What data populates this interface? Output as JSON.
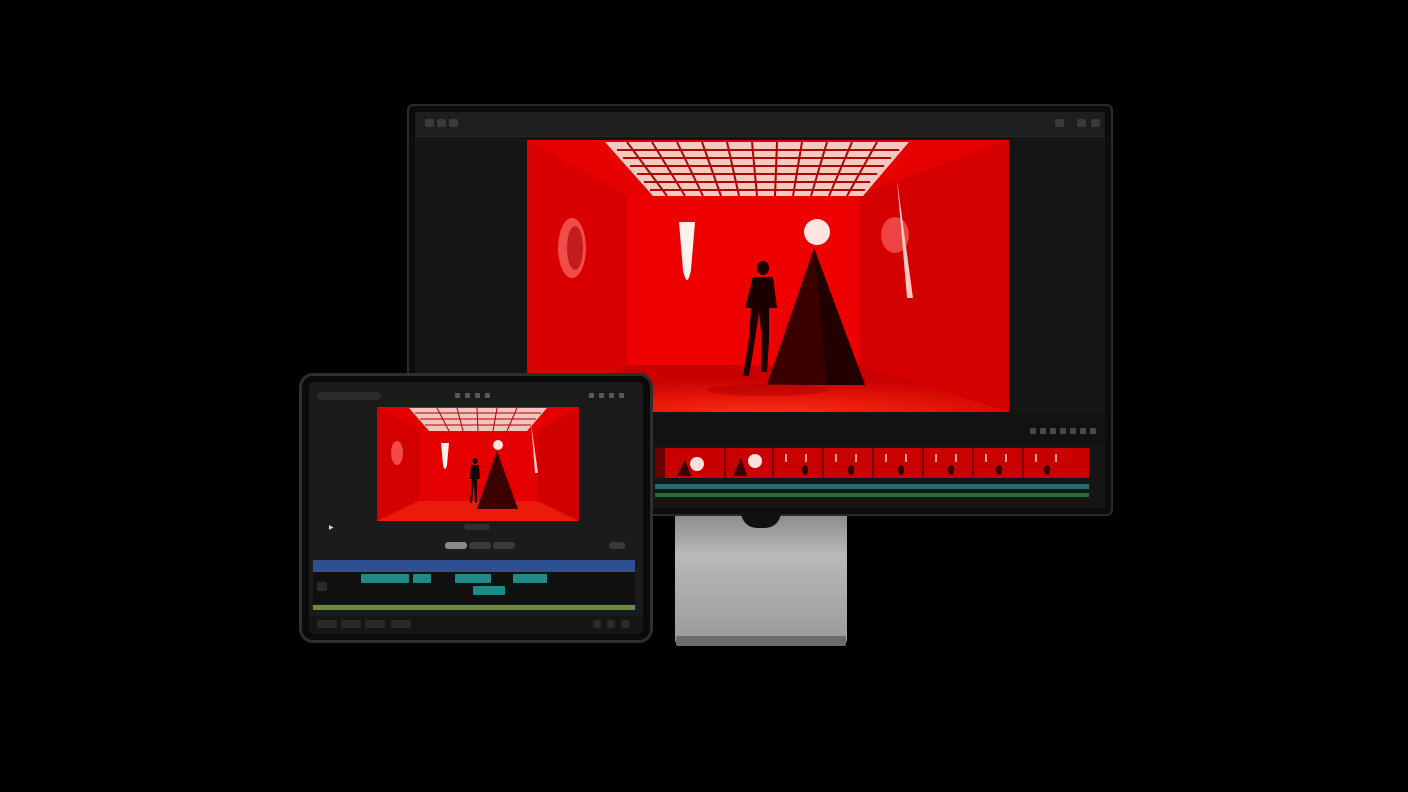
{
  "monitor": {
    "title": "",
    "accent_film": "#b00000"
  },
  "ipad": {
    "status_time": "",
    "project_name": ""
  },
  "colors": {
    "background": "#000000",
    "scene_red": "#e00000",
    "timeline_blue": "#2f4f93",
    "timeline_teal": "#1f8a8a",
    "timeline_green": "#6c8e2d"
  }
}
